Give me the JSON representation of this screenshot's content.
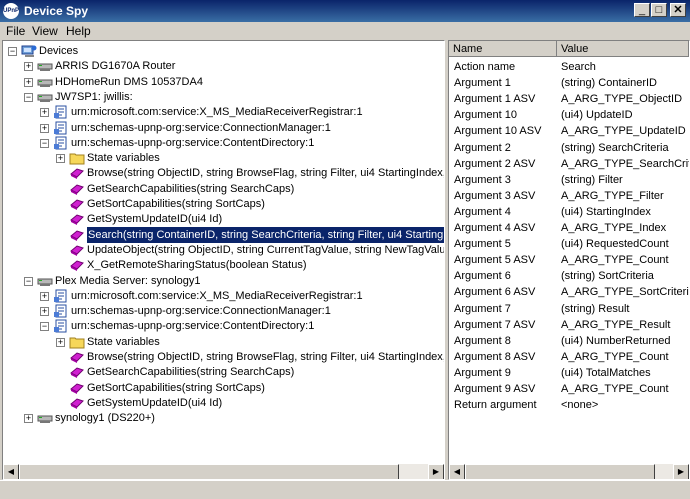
{
  "window": {
    "title": "Device Spy",
    "icon_label": "UPnP"
  },
  "menu": [
    "File",
    "View",
    "Help"
  ],
  "tree": {
    "rows": [
      {
        "label": "Devices",
        "type": "root",
        "level": 0,
        "exp": "minus"
      },
      {
        "label": "ARRIS DG1670A Router",
        "type": "device",
        "level": 1,
        "exp": "plus"
      },
      {
        "label": "HDHomeRun DMS 10537DA4",
        "type": "device",
        "level": 1,
        "exp": "plus"
      },
      {
        "label": "JW7SP1: jwillis:",
        "type": "device",
        "level": 1,
        "exp": "minus"
      },
      {
        "label": "urn:microsoft.com:service:X_MS_MediaReceiverRegistrar:1",
        "type": "service",
        "level": 2,
        "exp": "plus"
      },
      {
        "label": "urn:schemas-upnp-org:service:ConnectionManager:1",
        "type": "service",
        "level": 2,
        "exp": "plus"
      },
      {
        "label": "urn:schemas-upnp-org:service:ContentDirectory:1",
        "type": "service",
        "level": 2,
        "exp": "minus"
      },
      {
        "label": "State variables",
        "type": "folder",
        "level": 3,
        "exp": "plus"
      },
      {
        "label": "Browse(string ObjectID, string BrowseFlag, string Filter, ui4 StartingIndex, ui4",
        "type": "action",
        "level": 3
      },
      {
        "label": "GetSearchCapabilities(string SearchCaps)",
        "type": "action",
        "level": 3
      },
      {
        "label": "GetSortCapabilities(string SortCaps)",
        "type": "action",
        "level": 3
      },
      {
        "label": "GetSystemUpdateID(ui4 Id)",
        "type": "action",
        "level": 3
      },
      {
        "label": "Search(string ContainerID, string SearchCriteria, string Filter, ui4 StartingIndex",
        "type": "action",
        "level": 3,
        "selected": true
      },
      {
        "label": "UpdateObject(string ObjectID, string CurrentTagValue, string NewTagValue)",
        "type": "action",
        "level": 3
      },
      {
        "label": "X_GetRemoteSharingStatus(boolean Status)",
        "type": "action",
        "level": 3
      },
      {
        "label": "Plex Media Server: synology1",
        "type": "device",
        "level": 1,
        "exp": "minus"
      },
      {
        "label": "urn:microsoft.com:service:X_MS_MediaReceiverRegistrar:1",
        "type": "service",
        "level": 2,
        "exp": "plus"
      },
      {
        "label": "urn:schemas-upnp-org:service:ConnectionManager:1",
        "type": "service",
        "level": 2,
        "exp": "plus"
      },
      {
        "label": "urn:schemas-upnp-org:service:ContentDirectory:1",
        "type": "service",
        "level": 2,
        "exp": "minus"
      },
      {
        "label": "State variables",
        "type": "folder",
        "level": 3,
        "exp": "plus"
      },
      {
        "label": "Browse(string ObjectID, string BrowseFlag, string Filter, ui4 StartingIndex, ui4",
        "type": "action",
        "level": 3
      },
      {
        "label": "GetSearchCapabilities(string SearchCaps)",
        "type": "action",
        "level": 3
      },
      {
        "label": "GetSortCapabilities(string SortCaps)",
        "type": "action",
        "level": 3
      },
      {
        "label": "GetSystemUpdateID(ui4 Id)",
        "type": "action",
        "level": 3
      },
      {
        "label": "synology1 (DS220+)",
        "type": "device",
        "level": 1,
        "exp": "plus"
      }
    ]
  },
  "props": {
    "headers": {
      "name": "Name",
      "value": "Value"
    },
    "rows": [
      {
        "name": "Action name",
        "value": "Search"
      },
      {
        "name": "Argument 1",
        "value": "(string) ContainerID"
      },
      {
        "name": "Argument 1 ASV",
        "value": "A_ARG_TYPE_ObjectID"
      },
      {
        "name": "Argument 10",
        "value": "(ui4) UpdateID"
      },
      {
        "name": "Argument 10 ASV",
        "value": "A_ARG_TYPE_UpdateID"
      },
      {
        "name": "Argument 2",
        "value": "(string) SearchCriteria"
      },
      {
        "name": "Argument 2 ASV",
        "value": "A_ARG_TYPE_SearchCriteri"
      },
      {
        "name": "Argument 3",
        "value": "(string) Filter"
      },
      {
        "name": "Argument 3 ASV",
        "value": "A_ARG_TYPE_Filter"
      },
      {
        "name": "Argument 4",
        "value": "(ui4) StartingIndex"
      },
      {
        "name": "Argument 4 ASV",
        "value": "A_ARG_TYPE_Index"
      },
      {
        "name": "Argument 5",
        "value": "(ui4) RequestedCount"
      },
      {
        "name": "Argument 5 ASV",
        "value": "A_ARG_TYPE_Count"
      },
      {
        "name": "Argument 6",
        "value": "(string) SortCriteria"
      },
      {
        "name": "Argument 6 ASV",
        "value": "A_ARG_TYPE_SortCriteria"
      },
      {
        "name": "Argument 7",
        "value": "(string) Result"
      },
      {
        "name": "Argument 7 ASV",
        "value": "A_ARG_TYPE_Result"
      },
      {
        "name": "Argument 8",
        "value": "(ui4) NumberReturned"
      },
      {
        "name": "Argument 8 ASV",
        "value": "A_ARG_TYPE_Count"
      },
      {
        "name": "Argument 9",
        "value": "(ui4) TotalMatches"
      },
      {
        "name": "Argument 9 ASV",
        "value": "A_ARG_TYPE_Count"
      },
      {
        "name": "Return argument",
        "value": "<none>"
      }
    ]
  }
}
